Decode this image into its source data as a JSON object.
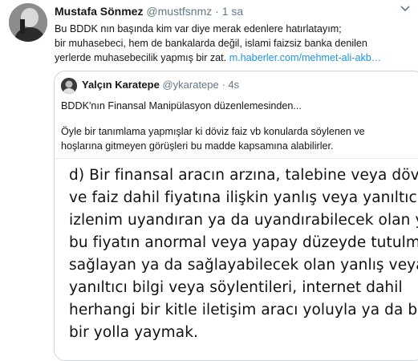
{
  "tweet": {
    "name": "Mustafa Sönmez",
    "handle": "@mustfsnmz",
    "separator": "·",
    "time": "1 sa",
    "lines": [
      "Bu BDDK nın başında kim var diye merak edenlere hatırlatayım;",
      "bir muhasebeci, hem de bankalarda değil, islami faizsiz banka denilen",
      "yerlerde muhasebecilik yapmış bir zat."
    ],
    "link": "m.haberler.com/mehmet-ali-akb…",
    "menu_icon": "chevron-down-icon"
  },
  "quote": {
    "name": "Yalçın Karatepe",
    "handle": "@ykaratepe",
    "separator": "·",
    "time": "4s",
    "line1": "BDDK'nın Finansal Manipülasyon düzenlemesinden...",
    "line2": "Öyle bir tanımlama yapmışlar ki döviz faiz vb konularda söylenen ve",
    "line3": "hoşlarına gitmeyen görüşleri bu madde kapsamına alabilirler.",
    "image_lines": [
      "d) Bir finansal aracın arzına, talebine veya dövizi",
      "ve faiz dahil fiyatına ilişkin yanlış veya yanıltıcı",
      "izlenim uyandıran ya da uyandırabilecek olan y",
      "bu fiyatın anormal veya yapay düzeyde tutulma",
      "sağlayan ya da sağlayabilecek olan yanlış veya",
      "yanıltıcı bilgi veya söylentileri, internet dahil",
      "herhangi bir kitle iletişim aracı yoluyla ya da ba",
      "bir yolla yaymak."
    ]
  }
}
